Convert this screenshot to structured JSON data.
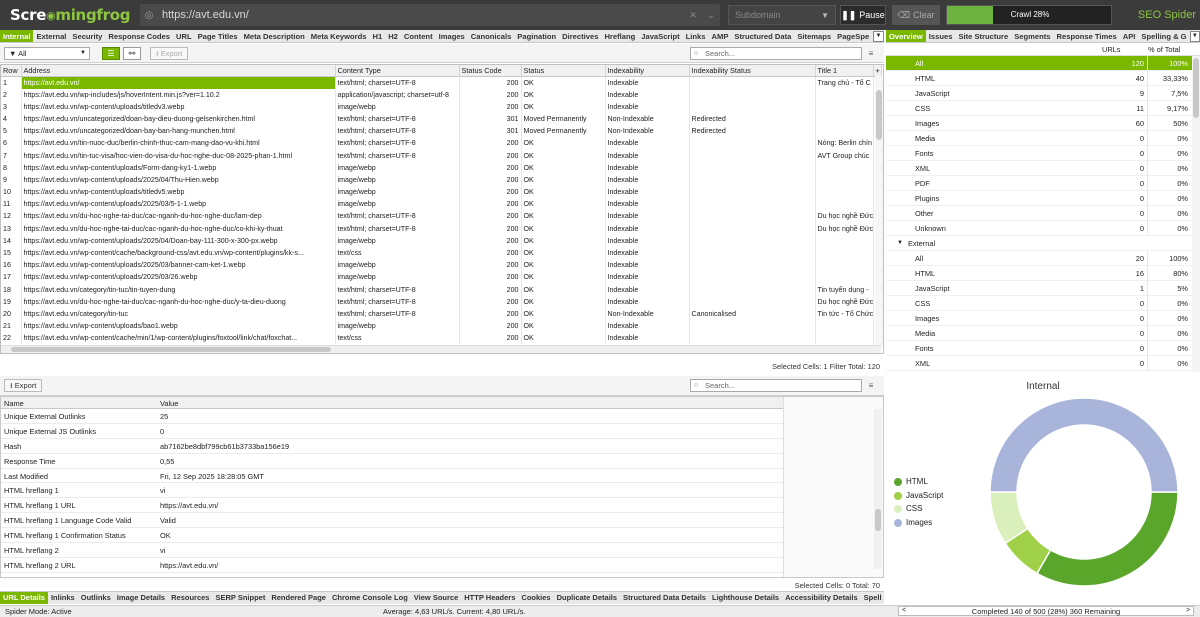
{
  "topbar": {
    "logo_left": "Scre",
    "logo_right": "mingfrog",
    "url": "https://avt.edu.vn/",
    "subdomain": "Subdomain",
    "pause": "Pause",
    "clear": "Clear",
    "crawl_progress_label": "Crawl 28%",
    "crawl_progress_value": 0.28,
    "brand": "SEO Spider"
  },
  "main_tabs": [
    "Internal",
    "External",
    "Security",
    "Response Codes",
    "URL",
    "Page Titles",
    "Meta Description",
    "Meta Keywords",
    "H1",
    "H2",
    "Content",
    "Images",
    "Canonicals",
    "Pagination",
    "Directives",
    "Hreflang",
    "JavaScript",
    "Links",
    "AMP",
    "Structured Data",
    "Sitemaps",
    "PageSpe"
  ],
  "right_tabs": [
    "Overview",
    "Issues",
    "Site Structure",
    "Segments",
    "Response Times",
    "API",
    "Spelling & G"
  ],
  "filter": {
    "selected": "All",
    "export": "Export",
    "search_placeholder": "Search..."
  },
  "grid": {
    "columns": [
      "Row",
      "Address",
      "Content Type",
      "Status Code",
      "Status",
      "Indexability",
      "Indexability Status",
      "Title 1"
    ],
    "rows": [
      [
        "1",
        "https://avt.edu.vn/",
        "text/html; charset=UTF-8",
        "200",
        "OK",
        "Indexable",
        "",
        "Trang chủ - Tổ C"
      ],
      [
        "2",
        "https://avt.edu.vn/wp-includes/js/hoverIntent.min.js?ver=1.10.2",
        "application/javascript; charset=utf-8",
        "200",
        "OK",
        "Indexable",
        "",
        ""
      ],
      [
        "3",
        "https://avt.edu.vn/wp-content/uploads/titledv3.webp",
        "image/webp",
        "200",
        "OK",
        "Indexable",
        "",
        ""
      ],
      [
        "4",
        "https://avt.edu.vn/uncategorized/doan-bay-dieu-duong-gelsenkirchen.html",
        "text/html; charset=UTF-8",
        "301",
        "Moved Permanently",
        "Non-Indexable",
        "Redirected",
        ""
      ],
      [
        "5",
        "https://avt.edu.vn/uncategorized/doan-bay-ban-hang-munchen.html",
        "text/html; charset=UTF-8",
        "301",
        "Moved Permanently",
        "Non-Indexable",
        "Redirected",
        ""
      ],
      [
        "6",
        "https://avt.edu.vn/tin-nuoc-duc/berlin-chinh-thuc-cam-mang-dao-vu-khi.html",
        "text/html; charset=UTF-8",
        "200",
        "OK",
        "Indexable",
        "",
        "Nóng: Berlin chín"
      ],
      [
        "7",
        "https://avt.edu.vn/tin-tuc-visa/hoc-vien-do-visa-du-hoc-nghe-duc-08-2025-phan-1.html",
        "text/html; charset=UTF-8",
        "200",
        "OK",
        "Indexable",
        "",
        "AVT Group chúc"
      ],
      [
        "8",
        "https://avt.edu.vn/wp-content/uploads/Form-dang-ky1-1.webp",
        "image/webp",
        "200",
        "OK",
        "Indexable",
        "",
        ""
      ],
      [
        "9",
        "https://avt.edu.vn/wp-content/uploads/2025/04/Thu-Hien.webp",
        "image/webp",
        "200",
        "OK",
        "Indexable",
        "",
        ""
      ],
      [
        "10",
        "https://avt.edu.vn/wp-content/uploads/titledv5.webp",
        "image/webp",
        "200",
        "OK",
        "Indexable",
        "",
        ""
      ],
      [
        "11",
        "https://avt.edu.vn/wp-content/uploads/2025/03/5-1-1.webp",
        "image/webp",
        "200",
        "OK",
        "Indexable",
        "",
        ""
      ],
      [
        "12",
        "https://avt.edu.vn/du-hoc-nghe-tai-duc/cac-nganh-du-hoc-nghe-duc/lam-dep",
        "text/html; charset=UTF-8",
        "200",
        "OK",
        "Indexable",
        "",
        "Du học nghề Đức"
      ],
      [
        "13",
        "https://avt.edu.vn/du-hoc-nghe-tai-duc/cac-nganh-du-hoc-nghe-duc/co-khi-ky-thuat",
        "text/html; charset=UTF-8",
        "200",
        "OK",
        "Indexable",
        "",
        "Du học nghề Đức"
      ],
      [
        "14",
        "https://avt.edu.vn/wp-content/uploads/2025/04/Doan-bay-111-300-x-300-px.webp",
        "image/webp",
        "200",
        "OK",
        "Indexable",
        "",
        ""
      ],
      [
        "15",
        "https://avt.edu.vn/wp-content/cache/background-css/avt.edu.vn/wp-content/plugins/kk-s...",
        "text/css",
        "200",
        "OK",
        "Indexable",
        "",
        ""
      ],
      [
        "16",
        "https://avt.edu.vn/wp-content/uploads/2025/03/banner-cam-ket-1.webp",
        "image/webp",
        "200",
        "OK",
        "Indexable",
        "",
        ""
      ],
      [
        "17",
        "https://avt.edu.vn/wp-content/uploads/2025/03/26.webp",
        "image/webp",
        "200",
        "OK",
        "Indexable",
        "",
        ""
      ],
      [
        "18",
        "https://avt.edu.vn/category/tin-tuc/tin-tuyen-dung",
        "text/html; charset=UTF-8",
        "200",
        "OK",
        "Indexable",
        "",
        "Tin tuyển dụng -"
      ],
      [
        "19",
        "https://avt.edu.vn/du-hoc-nghe-tai-duc/cac-nganh-du-hoc-nghe-duc/y-ta-dieu-duong",
        "text/html; charset=UTF-8",
        "200",
        "OK",
        "Indexable",
        "",
        "Du học nghề Đức"
      ],
      [
        "20",
        "https://avt.edu.vn/category/tin-tuc",
        "text/html; charset=UTF-8",
        "200",
        "OK",
        "Non-Indexable",
        "Canonicalised",
        "Tin tức - Tổ Chức"
      ],
      [
        "21",
        "https://avt.edu.vn/wp-content/uploads/bao1.webp",
        "image/webp",
        "200",
        "OK",
        "Indexable",
        "",
        ""
      ],
      [
        "22",
        "https://avt.edu.vn/wp-content/cache/min/1/wp-content/plugins/foxtool/link/chat/foxchat...",
        "text/css",
        "200",
        "OK",
        "Indexable",
        "",
        ""
      ]
    ],
    "status_text": "Selected Cells:  1  Filter Total:  120"
  },
  "details": {
    "export": "Export",
    "search_placeholder": "Search...",
    "col_name": "Name",
    "col_value": "Value",
    "rows": [
      [
        "Unique External Outlinks",
        "25"
      ],
      [
        "Unique External JS Outlinks",
        "0"
      ],
      [
        "Hash",
        "ab7162be8dbf799cb61b3733ba156e19"
      ],
      [
        "Response Time",
        "0,55"
      ],
      [
        "Last Modified",
        "Fri, 12 Sep 2025 18:28:05 GMT"
      ],
      [
        "HTML hreflang 1",
        "vi"
      ],
      [
        "HTML hreflang 1 URL",
        "https://avt.edu.vn/"
      ],
      [
        "HTML hreflang 1 Language Code Valid",
        "Valid"
      ],
      [
        "HTML hreflang 1 Confirmation Status",
        "OK"
      ],
      [
        "HTML hreflang 2",
        "vi"
      ],
      [
        "HTML hreflang 2 URL",
        "https://avt.edu.vn/"
      ]
    ],
    "status_text": "Selected Cells:  0  Total:  70"
  },
  "bottom_tabs": [
    "URL Details",
    "Inlinks",
    "Outlinks",
    "Image Details",
    "Resources",
    "SERP Snippet",
    "Rendered Page",
    "Chrome Console Log",
    "View Source",
    "HTTP Headers",
    "Cookies",
    "Duplicate Details",
    "Structured Data Details",
    "Lighthouse Details",
    "Accessibility Details",
    "Spell"
  ],
  "overview": {
    "col_urls": "URLs",
    "col_pct": "% of Total",
    "internal_rows": [
      [
        "All",
        "120",
        "100%"
      ],
      [
        "HTML",
        "40",
        "33,33%"
      ],
      [
        "JavaScript",
        "9",
        "7,5%"
      ],
      [
        "CSS",
        "11",
        "9,17%"
      ],
      [
        "Images",
        "60",
        "50%"
      ],
      [
        "Media",
        "0",
        "0%"
      ],
      [
        "Fonts",
        "0",
        "0%"
      ],
      [
        "XML",
        "0",
        "0%"
      ],
      [
        "PDF",
        "0",
        "0%"
      ],
      [
        "Plugins",
        "0",
        "0%"
      ],
      [
        "Other",
        "0",
        "0%"
      ],
      [
        "Unknown",
        "0",
        "0%"
      ]
    ],
    "external_label": "External",
    "external_rows": [
      [
        "All",
        "20",
        "100%"
      ],
      [
        "HTML",
        "16",
        "80%"
      ],
      [
        "JavaScript",
        "1",
        "5%"
      ],
      [
        "CSS",
        "0",
        "0%"
      ],
      [
        "Images",
        "0",
        "0%"
      ],
      [
        "Media",
        "0",
        "0%"
      ],
      [
        "Fonts",
        "0",
        "0%"
      ],
      [
        "XML",
        "0",
        "0%"
      ]
    ]
  },
  "chart_data": {
    "type": "pie",
    "title": "Internal",
    "categories": [
      "HTML",
      "JavaScript",
      "CSS",
      "Images"
    ],
    "values": [
      40,
      9,
      11,
      60
    ],
    "colors": [
      "#5aa62a",
      "#9fd048",
      "#d9f0bc",
      "#a8b4da"
    ],
    "legend_position": "left"
  },
  "footer": {
    "mode": "Spider Mode: Active",
    "speed": "Average: 4,63 URL/s. Current: 4,80 URL/s.",
    "completed": "Completed 140 of 500 (28%) 360 Remaining"
  }
}
